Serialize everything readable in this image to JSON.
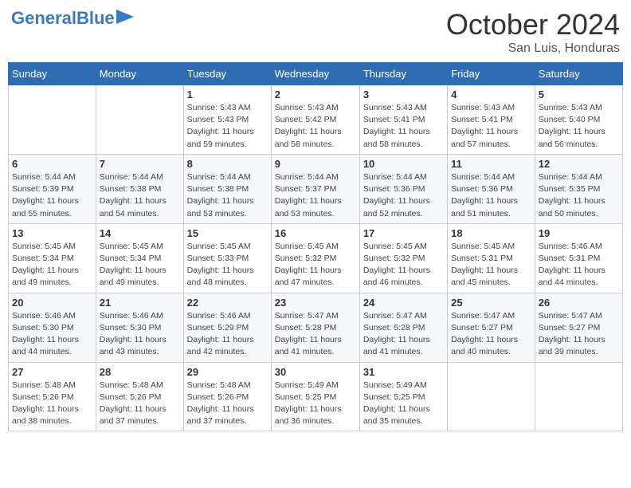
{
  "logo": {
    "part1": "General",
    "part2": "Blue"
  },
  "header": {
    "month": "October 2024",
    "location": "San Luis, Honduras"
  },
  "weekdays": [
    "Sunday",
    "Monday",
    "Tuesday",
    "Wednesday",
    "Thursday",
    "Friday",
    "Saturday"
  ],
  "weeks": [
    [
      {
        "day": "",
        "info": ""
      },
      {
        "day": "",
        "info": ""
      },
      {
        "day": "1",
        "info": "Sunrise: 5:43 AM\nSunset: 5:43 PM\nDaylight: 11 hours and 59 minutes."
      },
      {
        "day": "2",
        "info": "Sunrise: 5:43 AM\nSunset: 5:42 PM\nDaylight: 11 hours and 58 minutes."
      },
      {
        "day": "3",
        "info": "Sunrise: 5:43 AM\nSunset: 5:41 PM\nDaylight: 11 hours and 58 minutes."
      },
      {
        "day": "4",
        "info": "Sunrise: 5:43 AM\nSunset: 5:41 PM\nDaylight: 11 hours and 57 minutes."
      },
      {
        "day": "5",
        "info": "Sunrise: 5:43 AM\nSunset: 5:40 PM\nDaylight: 11 hours and 56 minutes."
      }
    ],
    [
      {
        "day": "6",
        "info": "Sunrise: 5:44 AM\nSunset: 5:39 PM\nDaylight: 11 hours and 55 minutes."
      },
      {
        "day": "7",
        "info": "Sunrise: 5:44 AM\nSunset: 5:38 PM\nDaylight: 11 hours and 54 minutes."
      },
      {
        "day": "8",
        "info": "Sunrise: 5:44 AM\nSunset: 5:38 PM\nDaylight: 11 hours and 53 minutes."
      },
      {
        "day": "9",
        "info": "Sunrise: 5:44 AM\nSunset: 5:37 PM\nDaylight: 11 hours and 53 minutes."
      },
      {
        "day": "10",
        "info": "Sunrise: 5:44 AM\nSunset: 5:36 PM\nDaylight: 11 hours and 52 minutes."
      },
      {
        "day": "11",
        "info": "Sunrise: 5:44 AM\nSunset: 5:36 PM\nDaylight: 11 hours and 51 minutes."
      },
      {
        "day": "12",
        "info": "Sunrise: 5:44 AM\nSunset: 5:35 PM\nDaylight: 11 hours and 50 minutes."
      }
    ],
    [
      {
        "day": "13",
        "info": "Sunrise: 5:45 AM\nSunset: 5:34 PM\nDaylight: 11 hours and 49 minutes."
      },
      {
        "day": "14",
        "info": "Sunrise: 5:45 AM\nSunset: 5:34 PM\nDaylight: 11 hours and 49 minutes."
      },
      {
        "day": "15",
        "info": "Sunrise: 5:45 AM\nSunset: 5:33 PM\nDaylight: 11 hours and 48 minutes."
      },
      {
        "day": "16",
        "info": "Sunrise: 5:45 AM\nSunset: 5:32 PM\nDaylight: 11 hours and 47 minutes."
      },
      {
        "day": "17",
        "info": "Sunrise: 5:45 AM\nSunset: 5:32 PM\nDaylight: 11 hours and 46 minutes."
      },
      {
        "day": "18",
        "info": "Sunrise: 5:45 AM\nSunset: 5:31 PM\nDaylight: 11 hours and 45 minutes."
      },
      {
        "day": "19",
        "info": "Sunrise: 5:46 AM\nSunset: 5:31 PM\nDaylight: 11 hours and 44 minutes."
      }
    ],
    [
      {
        "day": "20",
        "info": "Sunrise: 5:46 AM\nSunset: 5:30 PM\nDaylight: 11 hours and 44 minutes."
      },
      {
        "day": "21",
        "info": "Sunrise: 5:46 AM\nSunset: 5:30 PM\nDaylight: 11 hours and 43 minutes."
      },
      {
        "day": "22",
        "info": "Sunrise: 5:46 AM\nSunset: 5:29 PM\nDaylight: 11 hours and 42 minutes."
      },
      {
        "day": "23",
        "info": "Sunrise: 5:47 AM\nSunset: 5:28 PM\nDaylight: 11 hours and 41 minutes."
      },
      {
        "day": "24",
        "info": "Sunrise: 5:47 AM\nSunset: 5:28 PM\nDaylight: 11 hours and 41 minutes."
      },
      {
        "day": "25",
        "info": "Sunrise: 5:47 AM\nSunset: 5:27 PM\nDaylight: 11 hours and 40 minutes."
      },
      {
        "day": "26",
        "info": "Sunrise: 5:47 AM\nSunset: 5:27 PM\nDaylight: 11 hours and 39 minutes."
      }
    ],
    [
      {
        "day": "27",
        "info": "Sunrise: 5:48 AM\nSunset: 5:26 PM\nDaylight: 11 hours and 38 minutes."
      },
      {
        "day": "28",
        "info": "Sunrise: 5:48 AM\nSunset: 5:26 PM\nDaylight: 11 hours and 37 minutes."
      },
      {
        "day": "29",
        "info": "Sunrise: 5:48 AM\nSunset: 5:26 PM\nDaylight: 11 hours and 37 minutes."
      },
      {
        "day": "30",
        "info": "Sunrise: 5:49 AM\nSunset: 5:25 PM\nDaylight: 11 hours and 36 minutes."
      },
      {
        "day": "31",
        "info": "Sunrise: 5:49 AM\nSunset: 5:25 PM\nDaylight: 11 hours and 35 minutes."
      },
      {
        "day": "",
        "info": ""
      },
      {
        "day": "",
        "info": ""
      }
    ]
  ]
}
